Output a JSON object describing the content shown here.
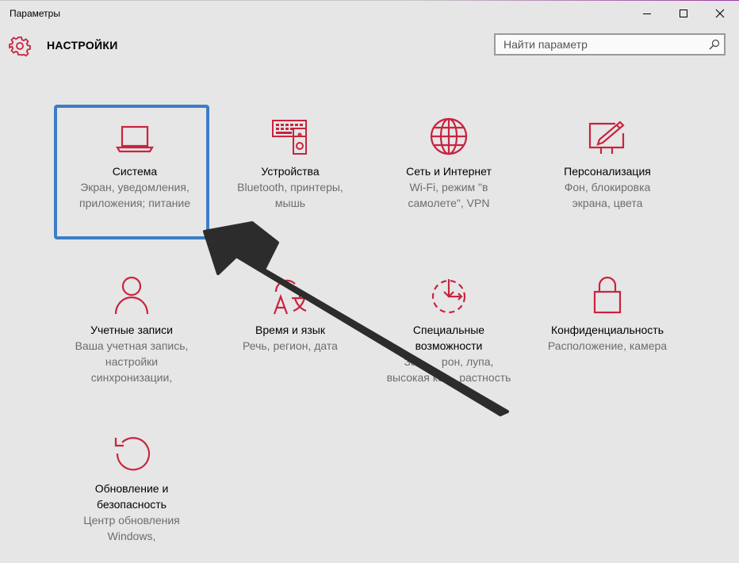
{
  "window": {
    "title": "Параметры"
  },
  "header": {
    "title": "НАСТРОЙКИ",
    "gear_icon": "gear-icon"
  },
  "search": {
    "placeholder": "Найти параметр",
    "value": ""
  },
  "colors": {
    "accent": "#c8243f",
    "selection_border": "#3d7ec5",
    "background": "#e6e6e6",
    "arrow": "#2c2c2c"
  },
  "tiles": [
    {
      "id": "system",
      "icon": "laptop-icon",
      "name": "Система",
      "desc": [
        "Экран, уведомления,",
        "приложения; питание"
      ],
      "selected": true
    },
    {
      "id": "devices",
      "icon": "devices-icon",
      "name": "Устройства",
      "desc": [
        "Bluetooth, принтеры,",
        "мышь"
      ]
    },
    {
      "id": "network",
      "icon": "globe-icon",
      "name": "Сеть и Интернет",
      "desc": [
        "Wi-Fi, режим \"в",
        "самолете\", VPN"
      ]
    },
    {
      "id": "personalization",
      "icon": "paint-icon",
      "name": "Персонализация",
      "desc": [
        "Фон, блокировка",
        "экрана, цвета"
      ]
    },
    {
      "id": "accounts",
      "icon": "person-icon",
      "name": "Учетные записи",
      "desc": [
        "Ваша учетная запись,",
        "настройки",
        "синхронизации,"
      ]
    },
    {
      "id": "time",
      "icon": "time-language-icon",
      "name": "Время и язык",
      "desc": [
        "Речь, регион, дата"
      ]
    },
    {
      "id": "ease",
      "icon": "accessibility-icon",
      "name": [
        "Специальные",
        "возможности"
      ],
      "desc": [
        "Экранный диктор, лупа,",
        "высокая контрастность"
      ],
      "desc_visible": [
        "За",
        "рон, лупа,",
        "высокая кон",
        "растность"
      ]
    },
    {
      "id": "privacy",
      "icon": "lock-icon",
      "name": "Конфиденциальность",
      "desc": [
        "Расположение, камера"
      ]
    },
    {
      "id": "update",
      "icon": "update-icon",
      "name": [
        "Обновление и",
        "безопасность"
      ],
      "desc": [
        "Центр обновления",
        "Windows,"
      ]
    }
  ]
}
